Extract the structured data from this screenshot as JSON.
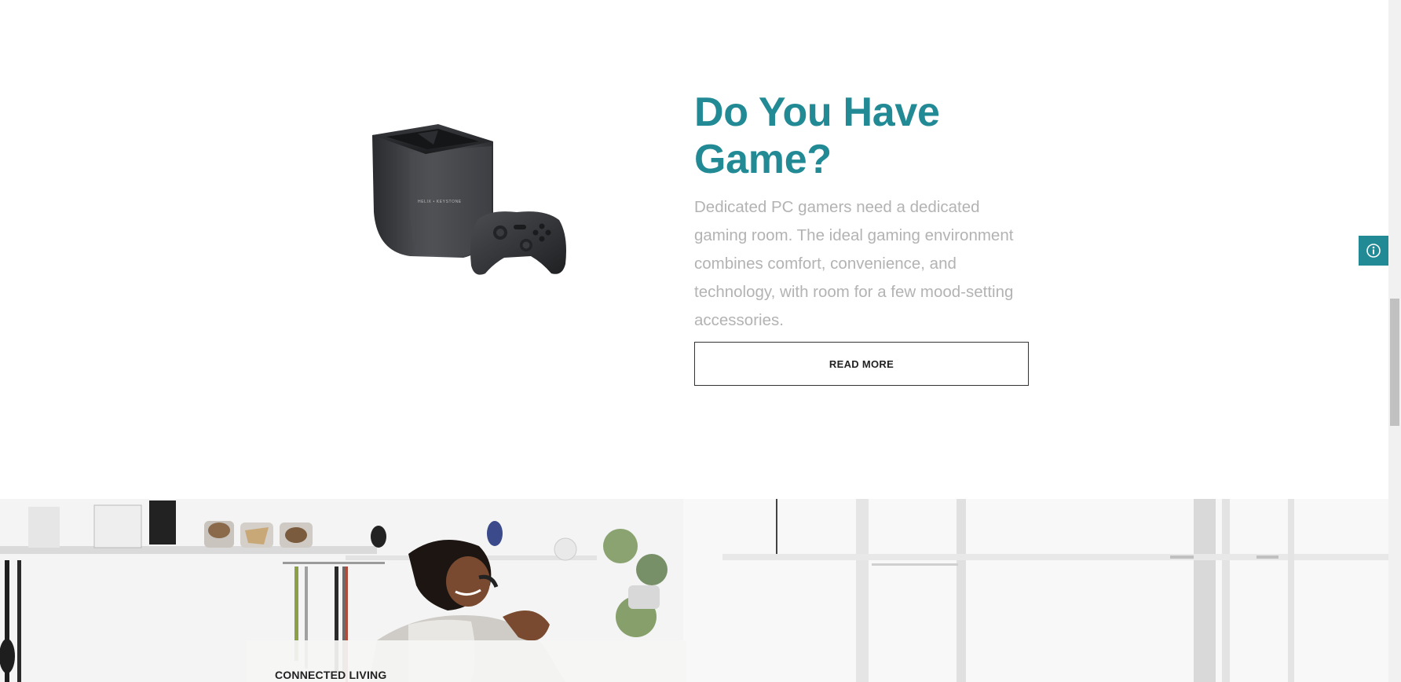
{
  "feature": {
    "title": "Do You Have Game?",
    "description": "Dedicated PC gamers need a dedicated gaming room. The ideal gaming environment combines comfort, convenience, and technology, with room for a few mood-setting accessories.",
    "read_more_label": "READ MORE",
    "product_brand_text": "HELIX • KEYSTONE"
  },
  "info_button": {
    "icon": "info-icon",
    "color": "#228a95"
  },
  "hero": {
    "card_label": "CONNECTED LIVING"
  },
  "colors": {
    "accent": "#228a95",
    "body_text": "#b3b3b3",
    "button_border": "#333333"
  }
}
